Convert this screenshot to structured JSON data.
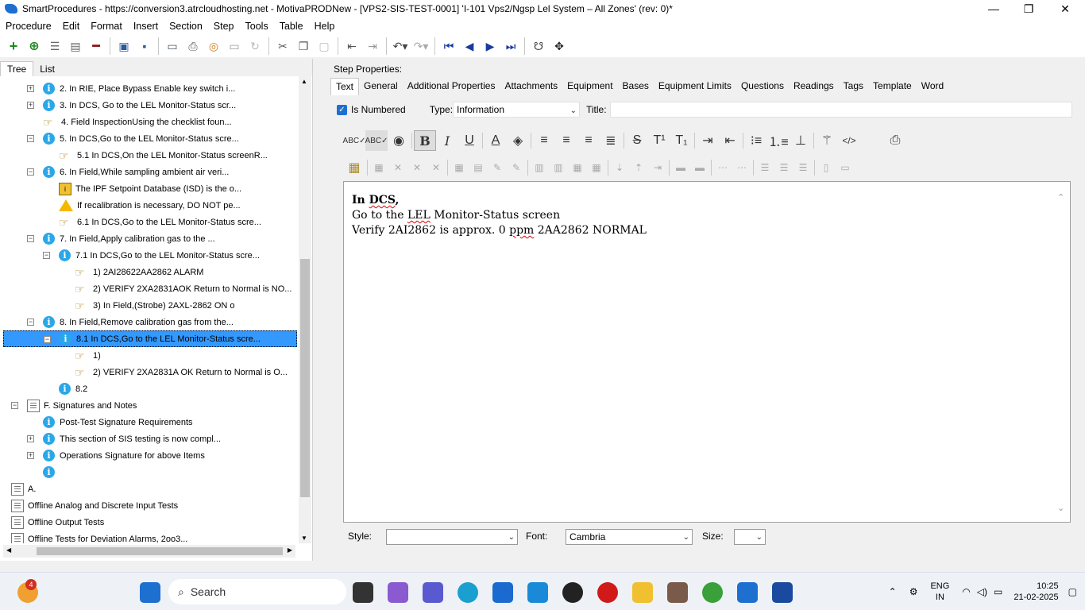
{
  "window": {
    "title": "SmartProcedures - https://conversion3.atrcloudhosting.net - MotivaPRODNew - [VPS2-SIS-TEST-0001] 'I-101 Vps2/Ngsp Lel System – All Zones' (rev: 0)*",
    "minimize": "—",
    "maximize": "❐",
    "close": "✕"
  },
  "menu": [
    "Procedure",
    "Edit",
    "Format",
    "Insert",
    "Section",
    "Step",
    "Tools",
    "Table",
    "Help"
  ],
  "left_tabs": [
    "Tree",
    "List"
  ],
  "tree": [
    {
      "label": "2. In RIE, Place Bypass Enable key switch i...",
      "icon": "info",
      "exp": "+"
    },
    {
      "label": "3. In DCS, Go to the LEL Monitor-Status scr...",
      "icon": "info",
      "exp": "+"
    },
    {
      "label": "4. Field InspectionUsing the checklist foun...",
      "icon": "hand",
      "exp": ""
    },
    {
      "label": "5. In DCS,Go to the LEL Monitor-Status scre...",
      "icon": "info",
      "exp": "−"
    },
    {
      "label": "5.1 In DCS,On the LEL Monitor-Status screenR...",
      "icon": "hand",
      "exp": ""
    },
    {
      "label": "6. In Field,While sampling ambient air veri...",
      "icon": "info",
      "exp": "−"
    },
    {
      "label": "The IPF Setpoint Database (ISD) is the o...",
      "icon": "isd",
      "exp": ""
    },
    {
      "label": "If recalibration is necessary, DO NOT pe...",
      "icon": "warn",
      "exp": ""
    },
    {
      "label": "6.1 In DCS,Go to the LEL Monitor-Status scre...",
      "icon": "hand",
      "exp": ""
    },
    {
      "label": "7. In Field,Apply calibration gas to the ...",
      "icon": "info",
      "exp": "−"
    },
    {
      "label": "7.1 In DCS,Go to the LEL Monitor-Status scre...",
      "icon": "info",
      "exp": "−"
    },
    {
      "label": "1) 2AI28622AA2862 ALARM",
      "icon": "hand",
      "exp": ""
    },
    {
      "label": "2) VERIFY 2XA2831AOK Return to Normal is NO...",
      "icon": "hand",
      "exp": ""
    },
    {
      "label": "3) In Field,(Strobe) 2AXL-2862 ON o",
      "icon": "hand",
      "exp": ""
    },
    {
      "label": "8. In Field,Remove calibration gas from the...",
      "icon": "info",
      "exp": "−"
    },
    {
      "label": "8.1 In DCS,Go to the LEL Monitor-Status scre...",
      "icon": "info",
      "exp": "−",
      "selected": true
    },
    {
      "label": "1)",
      "icon": "hand",
      "exp": ""
    },
    {
      "label": "2) VERIFY 2XA2831A OK Return to Normal is O...",
      "icon": "hand",
      "exp": ""
    },
    {
      "label": "8.2",
      "icon": "info",
      "exp": ""
    },
    {
      "label": "F. Signatures and Notes",
      "icon": "doc",
      "exp": "−"
    },
    {
      "label": "Post-Test Signature Requirements",
      "icon": "info",
      "exp": ""
    },
    {
      "label": "This section of SIS testing is now compl...",
      "icon": "info",
      "exp": "+"
    },
    {
      "label": "Operations Signature for above Items",
      "icon": "info",
      "exp": "+"
    },
    {
      "label": "",
      "icon": "info",
      "exp": ""
    },
    {
      "label": "A.",
      "icon": "doc",
      "exp": ""
    },
    {
      "label": "Offline Analog and Discrete Input Tests",
      "icon": "doc",
      "exp": ""
    },
    {
      "label": "Offline Output Tests",
      "icon": "doc",
      "exp": ""
    },
    {
      "label": "Offline Tests for Deviation Alarms, 2oo3...",
      "icon": "doc",
      "exp": ""
    }
  ],
  "step_props": {
    "label": "Step Properties:",
    "tabs": [
      "Text",
      "General",
      "Additional Properties",
      "Attachments",
      "Equipment",
      "Bases",
      "Equipment Limits",
      "Questions",
      "Readings",
      "Tags",
      "Template",
      "Word"
    ],
    "is_numbered_label": "Is Numbered",
    "type_label": "Type:",
    "type_value": "Information",
    "title_label": "Title:",
    "title_value": ""
  },
  "editor": {
    "line1_a": "In ",
    "line1_b": "DCS",
    "line1_c": ",",
    "line2_a": "Go to the ",
    "line2_b": "LEL",
    "line2_c": " Monitor-Status screen",
    "line3_a": "Verify 2AI2862 is approx. 0 ",
    "line3_b": "ppm",
    "line3_c": " 2AA2862 NORMAL"
  },
  "bottom": {
    "style_label": "Style:",
    "style_value": "",
    "font_label": "Font:",
    "font_value": "Cambria",
    "size_label": "Size:",
    "size_value": ""
  },
  "taskbar": {
    "search_placeholder": "Search",
    "badge": "4",
    "lang1": "ENG",
    "lang2": "IN",
    "time": "10:25",
    "date": "21-02-2025"
  }
}
